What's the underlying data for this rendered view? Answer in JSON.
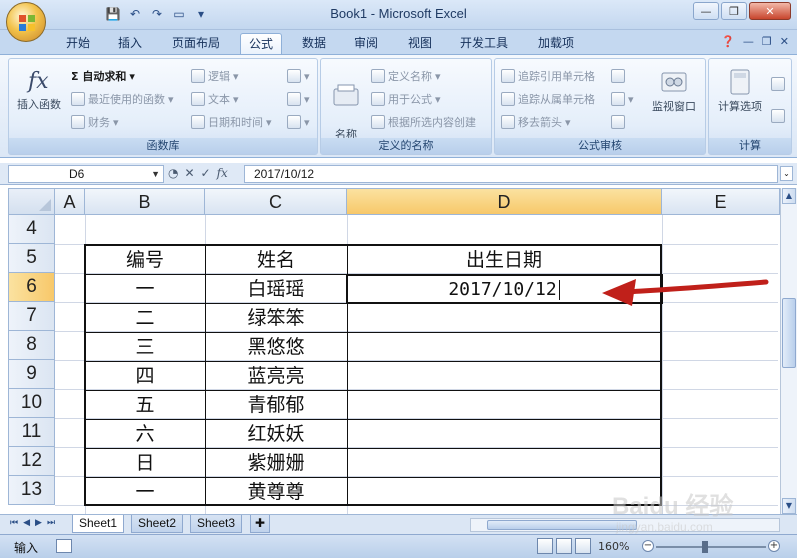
{
  "window": {
    "title": "Book1 - Microsoft Excel"
  },
  "tabs": [
    {
      "label": "开始"
    },
    {
      "label": "插入"
    },
    {
      "label": "页面布局"
    },
    {
      "label": "公式"
    },
    {
      "label": "数据"
    },
    {
      "label": "审阅"
    },
    {
      "label": "视图"
    },
    {
      "label": "开发工具"
    },
    {
      "label": "加载项"
    }
  ],
  "active_tab": "公式",
  "ribbon": {
    "function_library": {
      "title": "函数库",
      "insert_function": "插入函数",
      "autosum": "Σ 自动求和",
      "recently_used": "最近使用的函数",
      "financial": "财务",
      "logical": "逻辑",
      "text": "文本",
      "date_time": "日期和时间"
    },
    "defined_names": {
      "title": "定义的名称",
      "name_manager": "名称\n管理器",
      "define_name": "定义名称",
      "use_in_formula": "用于公式",
      "create_from_selection": "根据所选内容创建"
    },
    "formula_auditing": {
      "title": "公式审核",
      "trace_precedents": "追踪引用单元格",
      "trace_dependents": "追踪从属单元格",
      "remove_arrows": "移去箭头",
      "watch_window": "监视窗口"
    },
    "calculation": {
      "title": "计算",
      "calc_options": "计算选项"
    }
  },
  "formula_bar": {
    "name_box": "D6",
    "formula": "2017/10/12",
    "fx_label": "fx"
  },
  "sheet": {
    "columns": [
      "A",
      "B",
      "C",
      "D",
      "E"
    ],
    "rows": [
      "4",
      "5",
      "6",
      "7",
      "8",
      "9",
      "10",
      "11",
      "12",
      "13"
    ],
    "selected_column": "D",
    "selected_row": "6",
    "header_row": {
      "id_header": "编号",
      "name_header": "姓名",
      "birth_header": "出生日期"
    },
    "records": [
      {
        "id": "一",
        "name": "白瑶瑶",
        "date": "2017/10/12"
      },
      {
        "id": "二",
        "name": "绿笨笨",
        "date": ""
      },
      {
        "id": "三",
        "name": "黑悠悠",
        "date": ""
      },
      {
        "id": "四",
        "name": "蓝亮亮",
        "date": ""
      },
      {
        "id": "五",
        "name": "青郁郁",
        "date": ""
      },
      {
        "id": "六",
        "name": "红妖妖",
        "date": ""
      },
      {
        "id": "日",
        "name": "紫姗姗",
        "date": ""
      },
      {
        "id": "一",
        "name": "黄尊尊",
        "date": ""
      }
    ]
  },
  "sheet_tabs": [
    {
      "label": "Sheet1"
    },
    {
      "label": "Sheet2"
    },
    {
      "label": "Sheet3"
    }
  ],
  "active_sheet": "Sheet1",
  "status": {
    "mode": "输入",
    "zoom": "160%"
  },
  "watermark": {
    "brand": "Baidu 经验",
    "url": "jingyan.baidu.com"
  },
  "colors": {
    "accent": "#c3d7ef",
    "selection": "#f7c86a",
    "arrow": "#c0201a"
  }
}
